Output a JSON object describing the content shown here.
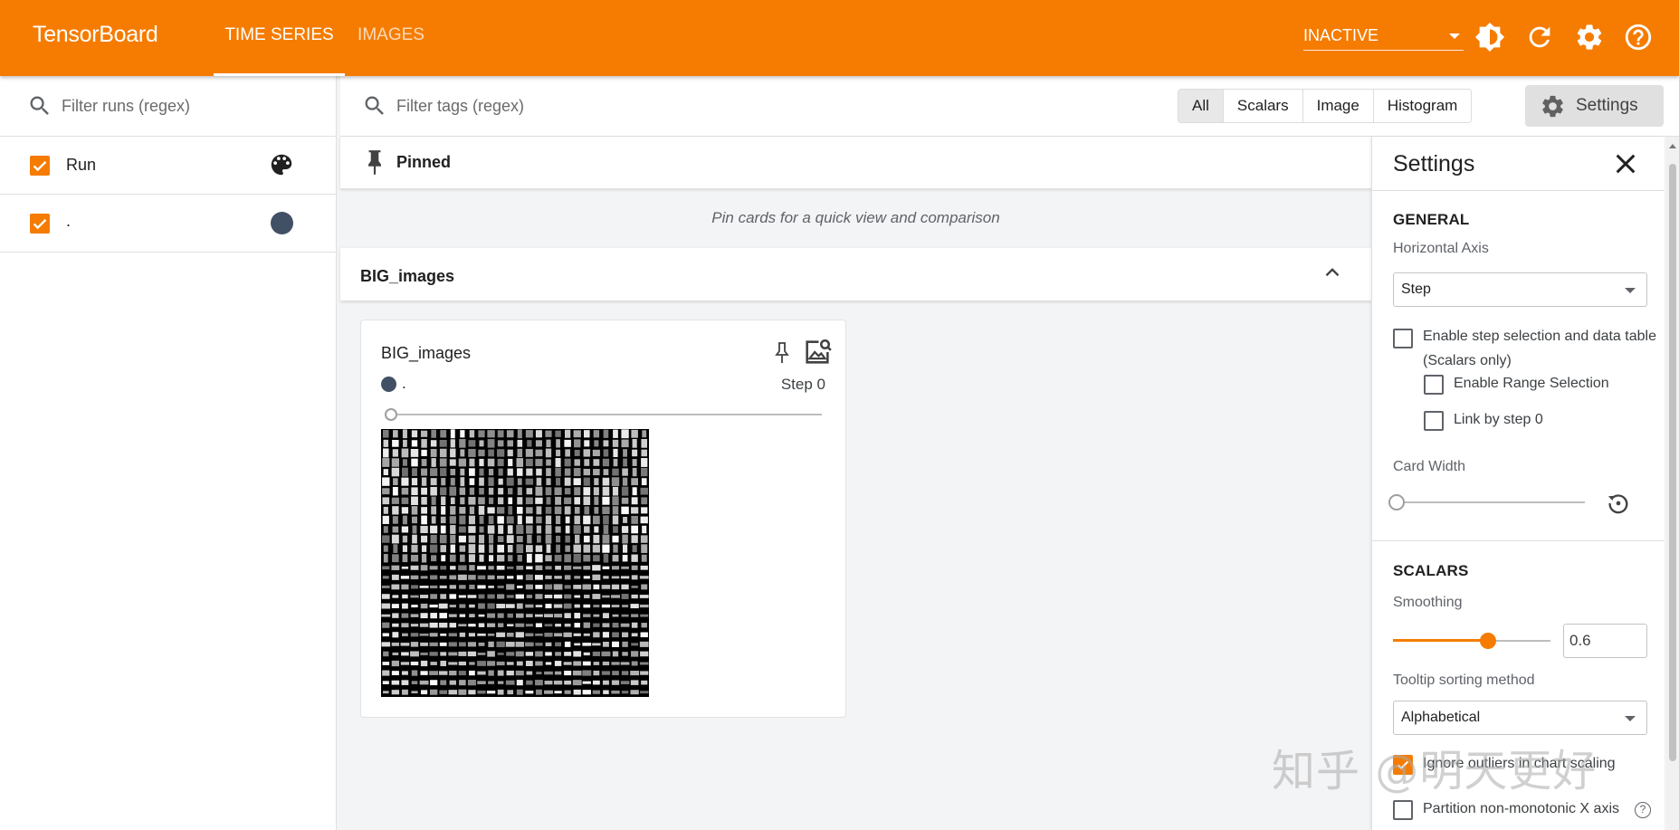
{
  "app": {
    "brand": "TensorBoard",
    "tabs": [
      "TIME SERIES",
      "IMAGES"
    ],
    "status": "INACTIVE",
    "accent": "#f57c00",
    "header_icons": [
      "theme-icon",
      "refresh-icon",
      "settings-gear-icon",
      "help-icon"
    ]
  },
  "sidebar": {
    "filter_placeholder": "Filter runs (regex)",
    "runs": [
      {
        "label": "Run",
        "checked": true,
        "icon": "palette-icon"
      },
      {
        "label": ".",
        "checked": true,
        "color": "#425066"
      }
    ]
  },
  "toolbar": {
    "filter_placeholder": "Filter tags (regex)",
    "chips": [
      "All",
      "Scalars",
      "Image",
      "Histogram"
    ],
    "active_chip": "All",
    "settings_label": "Settings"
  },
  "main": {
    "pinned_title": "Pinned",
    "pinned_empty": "Pin cards for a quick view and comparison",
    "group_title": "BIG_images",
    "card": {
      "title": "BIG_images",
      "run": ".",
      "step_label": "Step 0",
      "step_position": 0
    }
  },
  "settings": {
    "title": "Settings",
    "general_title": "GENERAL",
    "horizontal_axis_label": "Horizontal Axis",
    "horizontal_axis_value": "Step",
    "enable_step_selection": "Enable step selection and data table (Scalars only)",
    "enable_range_selection": "Enable Range Selection",
    "link_by_step": "Link by step 0",
    "card_width_label": "Card Width",
    "scalars_title": "SCALARS",
    "smoothing_label": "Smoothing",
    "smoothing_value": "0.6",
    "tooltip_sort_label": "Tooltip sorting method",
    "tooltip_sort_value": "Alphabetical",
    "ignore_outliers": "Ignore outliers in chart scaling",
    "ignore_outliers_checked": true,
    "partition_label": "Partition non-monotonic X axis",
    "partition_help": "?"
  },
  "watermark": "知乎 @明天更好"
}
